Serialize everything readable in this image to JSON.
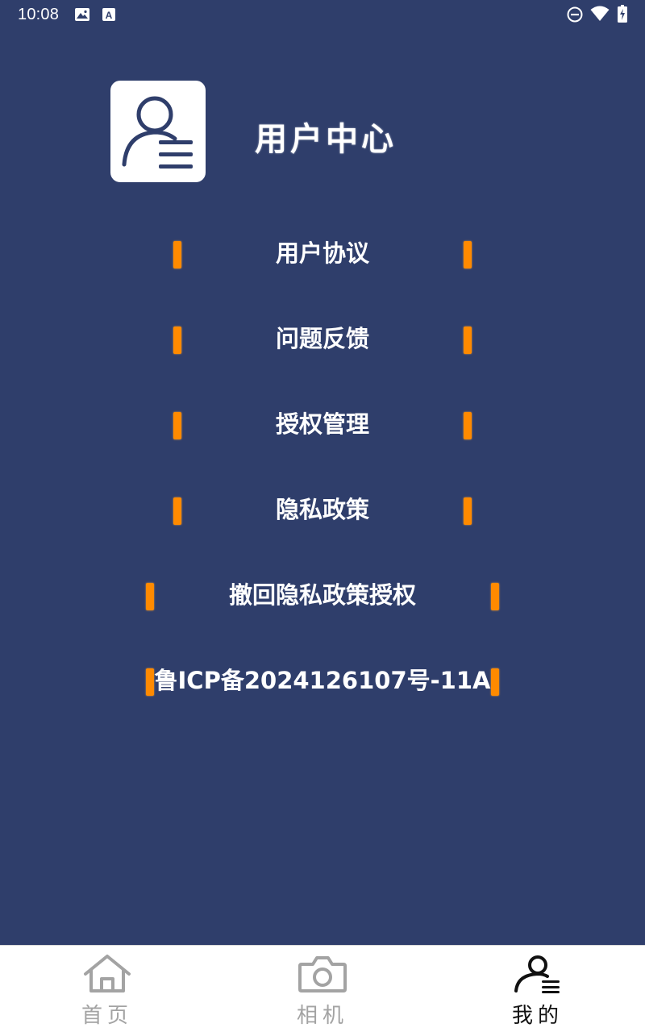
{
  "status_bar": {
    "time": "10:08",
    "icons": [
      "image-icon",
      "font-a-icon",
      "dnd-icon",
      "wifi-icon",
      "battery-icon"
    ]
  },
  "header": {
    "logo_icon": "user-list-icon",
    "title": "用户中心"
  },
  "menu": {
    "items": [
      {
        "label": "用户协议"
      },
      {
        "label": "问题反馈"
      },
      {
        "label": "授权管理"
      },
      {
        "label": "隐私政策"
      },
      {
        "label": "撤回隐私政策授权"
      },
      {
        "label": "鲁ICP备2024126107号-11A"
      }
    ]
  },
  "colors": {
    "background": "#2f3e6b",
    "accent_bar": "#ff8a00",
    "nav_inactive": "#a3a3a3",
    "nav_active": "#111111"
  },
  "bottom_nav": {
    "items": [
      {
        "label": "首页",
        "icon": "home-icon",
        "active": false
      },
      {
        "label": "相机",
        "icon": "camera-icon",
        "active": false
      },
      {
        "label": "我的",
        "icon": "user-icon",
        "active": true
      }
    ]
  }
}
